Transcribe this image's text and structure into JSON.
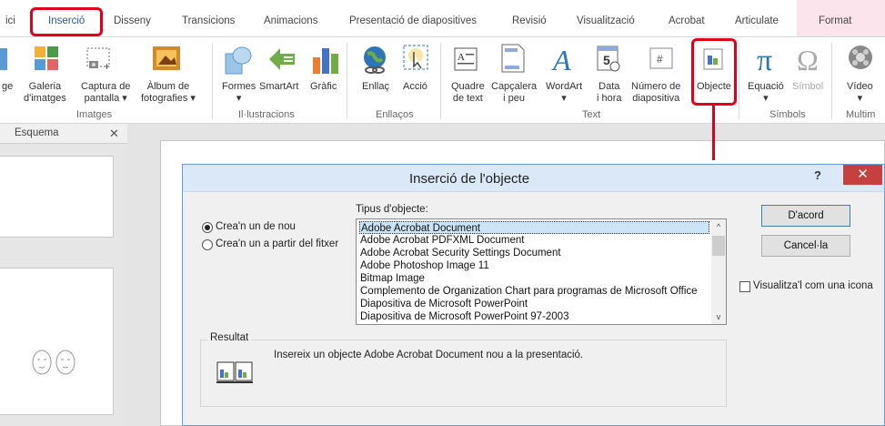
{
  "tabs": [
    {
      "label": "ici"
    },
    {
      "label": "Inserció"
    },
    {
      "label": "Disseny"
    },
    {
      "label": "Transicions"
    },
    {
      "label": "Animacions"
    },
    {
      "label": "Presentació de diapositives"
    },
    {
      "label": "Revisió"
    },
    {
      "label": "Visualització"
    },
    {
      "label": "Acrobat"
    },
    {
      "label": "Articulate"
    },
    {
      "label": "Format"
    }
  ],
  "ribbon": {
    "images": {
      "age": "ge",
      "galeria": [
        "Galeria",
        "d'imatges"
      ],
      "captura": [
        "Captura de",
        "pantalla ▾"
      ],
      "album": [
        "Àlbum de",
        "fotografies ▾"
      ],
      "group": "Imatges"
    },
    "illustrations": {
      "formes": "Formes",
      "smartart": "SmartArt",
      "grafic": "Gràfic",
      "dropdown": "▾",
      "group": "Il·lustracions"
    },
    "links": {
      "enllac": "Enllaç",
      "accio": "Acció",
      "group": "Enllaços"
    },
    "text": {
      "quadre": [
        "Quadre",
        "de text"
      ],
      "capcalera": [
        "Capçalera",
        "i peu"
      ],
      "wordart": [
        "WordArt",
        "▾"
      ],
      "data": [
        "Data",
        "i hora"
      ],
      "numero": [
        "Número de",
        "diapositiva"
      ],
      "objecte": "Objecte",
      "group": "Text",
      "calendar_number": "5"
    },
    "symbols": {
      "equacio": [
        "Equació",
        "▾"
      ],
      "simbol": "Símbol",
      "group": "Símbols"
    },
    "media": {
      "video": [
        "Vídeo",
        "▾"
      ],
      "group": "Multim"
    }
  },
  "pane": {
    "tab": "Esquema",
    "close": "✕"
  },
  "dialog": {
    "title": "Inserció de l'objecte",
    "help": "?",
    "close": "✕",
    "radio_new": "Crea'n un de nou",
    "radio_file": "Crea'n un a partir del fitxer",
    "list_label": "Tipus d'objecte:",
    "items": [
      "Adobe Acrobat Document",
      "Adobe Acrobat PDFXML Document",
      "Adobe Acrobat Security Settings Document",
      "Adobe Photoshop Image 11",
      "Bitmap Image",
      "Complemento de Organization Chart para programas de Microsoft Office",
      "Diapositiva de Microsoft PowerPoint",
      "Diapositiva de Microsoft PowerPoint 97-2003"
    ],
    "selected_index": 0,
    "ok": "D'acord",
    "cancel": "Cancel·la",
    "display_icon": "Visualitza'l com una icona",
    "result_label": "Resultat",
    "result_text": "Insereix un objecte Adobe Acrobat Document nou a la presentació.",
    "scroll_up": "^",
    "scroll_down": "v"
  },
  "colors": {
    "highlight": "#e0001b",
    "accent": "#2b579a"
  }
}
